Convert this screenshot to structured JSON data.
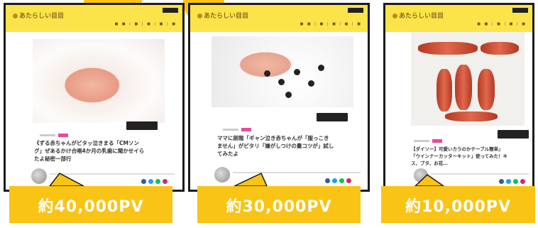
{
  "cards": [
    {
      "logo": "あたらしい目目",
      "title_lines": [
        "《ずる赤ちゃんがビタッ泣きまる「CMソン",
        "グ」ぜあるかけ合唱4か月の乳歯に聞かせイら",
        "たよ秘密一部行"
      ],
      "pv": "約40,000PV"
    },
    {
      "logo": "あたらしい目目",
      "title_lines": [
        "ママに朗報「ギャン泣き赤ちゃんが「服っこき",
        "ません」がピタリ「嫌がしつけの量コツが」試し",
        "てみたよ"
      ],
      "pv": "約30,000PV"
    },
    {
      "logo": "あたらしい目目",
      "title_lines": [
        "【ダイソー】可愛いカラのかテーブル簡単」",
        "「ウインナーカッターキット」使ってみた！キ",
        "ス、ブタ、お花…"
      ],
      "pv": "約10,000PV"
    }
  ],
  "colors": {
    "accent": "#f9c416",
    "header": "#fbe44a",
    "tag": "#e84b9c"
  }
}
